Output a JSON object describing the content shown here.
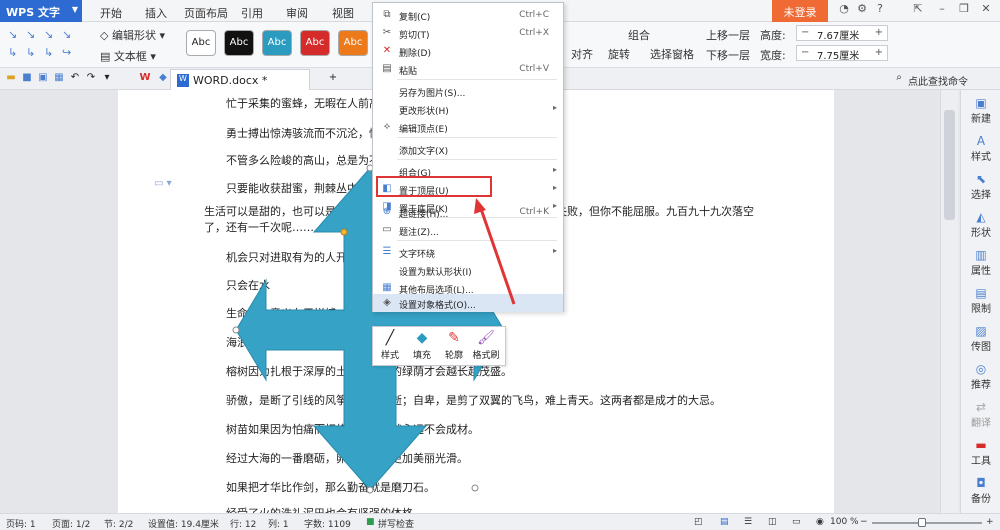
{
  "app": {
    "name": "WPS 文字"
  },
  "menu_tabs": [
    "开始",
    "插入",
    "页面布局",
    "引用",
    "审阅",
    "视图"
  ],
  "account": {
    "login": "未登录"
  },
  "ribbon": {
    "edit_shape": "编辑形状",
    "text_box": "文本框",
    "style_samples": [
      {
        "label": "Abc",
        "bg": "#ffffff",
        "fg": "#222222"
      },
      {
        "label": "Abc",
        "bg": "#111111",
        "fg": "#ffffff"
      },
      {
        "label": "Abc",
        "bg": "#2c9bc0",
        "fg": "#ffffff"
      },
      {
        "label": "Abc",
        "bg": "#d62b2b",
        "fg": "#ffffff"
      },
      {
        "label": "Abc",
        "bg": "#ec7a1a",
        "fg": "#ffffff"
      }
    ],
    "align": "对齐",
    "rotate": "旋转",
    "select_pane": "选择窗格",
    "group": "组合",
    "bring_forward": "上移一层",
    "send_backward": "下移一层",
    "height_label": "高度:",
    "height_value": "7.67厘米",
    "width_label": "宽度:",
    "width_value": "7.75厘米"
  },
  "doc_tab": {
    "name": "WORD.docx *"
  },
  "search": {
    "label": "点此查找命令"
  },
  "document": {
    "paragraphs": [
      "忙于采集的蜜蜂，无暇在人前高谈",
      "勇士搏出惊涛骇流而不沉沦，懦夫",
      "不管多么险峻的高山，总是为不畏",
      "只要能收获甜蜜，荆棘丛中也会",
      "生活可以是甜的，也可以是苦的，但不能是没味的。你可以胜利，也可以失败，但你不能屈服。九百九十九次落空了，还有一千次呢……",
      "机会只对进取有为的人开放",
      "只会在水",
      "生命力的意义在于拼搏，因",
      "海浪的品格，就是无数次被",
      "榕树因为扎根于深厚的土壤，生命的绿荫才会越长越茂盛。",
      "骄傲，是断了引线的风筝，稍纵即逝；自卑，是剪了双翼的飞鸟，难上青天。这两者都是成才的大忌。",
      "树苗如果因为怕痛而拒绝修剪，那就永远不会成材。",
      "经过大海的一番磨砺，卵石才变得更加美丽光滑。",
      "如果把才华比作剑，那么勤奋就是磨刀石。",
      "经受了火的洗礼泥巴也会有坚强的体格。"
    ]
  },
  "context_menu": {
    "items": [
      {
        "label": "复制(C)",
        "shortcut": "Ctrl+C",
        "icon": "copy-icon"
      },
      {
        "label": "剪切(T)",
        "shortcut": "Ctrl+X",
        "icon": "cut-icon"
      },
      {
        "label": "删除(D)",
        "shortcut": "",
        "icon": "delete-icon"
      },
      {
        "label": "粘贴",
        "shortcut": "Ctrl+V",
        "icon": "paste-icon"
      },
      {
        "label": "另存为图片(S)...",
        "shortcut": "",
        "icon": ""
      },
      {
        "label": "更改形状(H)",
        "shortcut": "",
        "icon": ""
      },
      {
        "label": "编辑顶点(E)",
        "shortcut": "",
        "icon": "edit-points-icon"
      },
      {
        "label": "添加文字(X)",
        "shortcut": "",
        "icon": ""
      },
      {
        "label": "组合(G)",
        "shortcut": "",
        "icon": ""
      },
      {
        "label": "置于顶层(U)",
        "shortcut": "",
        "icon": "bring-front-icon"
      },
      {
        "label": "置于底层(K)",
        "shortcut": "",
        "icon": "send-back-icon"
      },
      {
        "label": "超链接(H)...",
        "shortcut": "Ctrl+K",
        "icon": "hyperlink-icon"
      },
      {
        "label": "题注(Z)...",
        "shortcut": "",
        "icon": "caption-icon"
      },
      {
        "label": "文字环绕",
        "shortcut": "",
        "icon": "text-wrap-icon"
      },
      {
        "label": "设置为默认形状(I)",
        "shortcut": "",
        "icon": ""
      },
      {
        "label": "其他布局选项(L)...",
        "shortcut": "",
        "icon": "layout-icon"
      },
      {
        "label": "设置对象格式(O)...",
        "shortcut": "",
        "icon": "format-object-icon"
      }
    ]
  },
  "float_toolbar": {
    "items": [
      "样式",
      "填充",
      "轮廓",
      "格式刷"
    ]
  },
  "sidebar": {
    "items": [
      "新建",
      "样式",
      "选择",
      "形状",
      "属性",
      "限制",
      "传图",
      "推荐",
      "翻译",
      "工具",
      "备份"
    ]
  },
  "statusbar": {
    "page_num": "页码: 1",
    "pages": "页面: 1/2",
    "section": "节: 2/2",
    "position": "设置值: 19.4厘米",
    "row": "行: 12",
    "col": "列: 1",
    "words": "字数: 1109",
    "spell": "拼写检查",
    "zoom": "100 %"
  },
  "colors": {
    "accent": "#2d6ad1",
    "login": "#f06a35",
    "shape_fill": "#35a2c6",
    "highlight_border": "#e03535"
  }
}
